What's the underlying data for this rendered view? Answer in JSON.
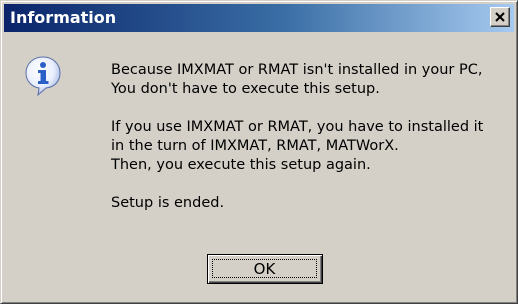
{
  "dialog": {
    "title": "Information",
    "close_label": "×",
    "icon": "information-icon",
    "message": {
      "paragraph1": {
        "line1": "Because IMXMAT or RMAT isn't installed in your PC,",
        "line2": "You don't have to execute this setup."
      },
      "paragraph2": {
        "line1": "If you use IMXMAT or RMAT, you have to installed it",
        "line2": "in the turn of IMXMAT, RMAT, MATWorX.",
        "line3": "Then, you execute this setup again."
      },
      "paragraph3": {
        "line1": "Setup is ended."
      }
    },
    "ok_label": "OK"
  },
  "colors": {
    "title_gradient_start": "#0a246a",
    "title_gradient_end": "#a6caf0",
    "dialog_face": "#d4d0c8",
    "icon_blue": "#2b5fc8"
  }
}
